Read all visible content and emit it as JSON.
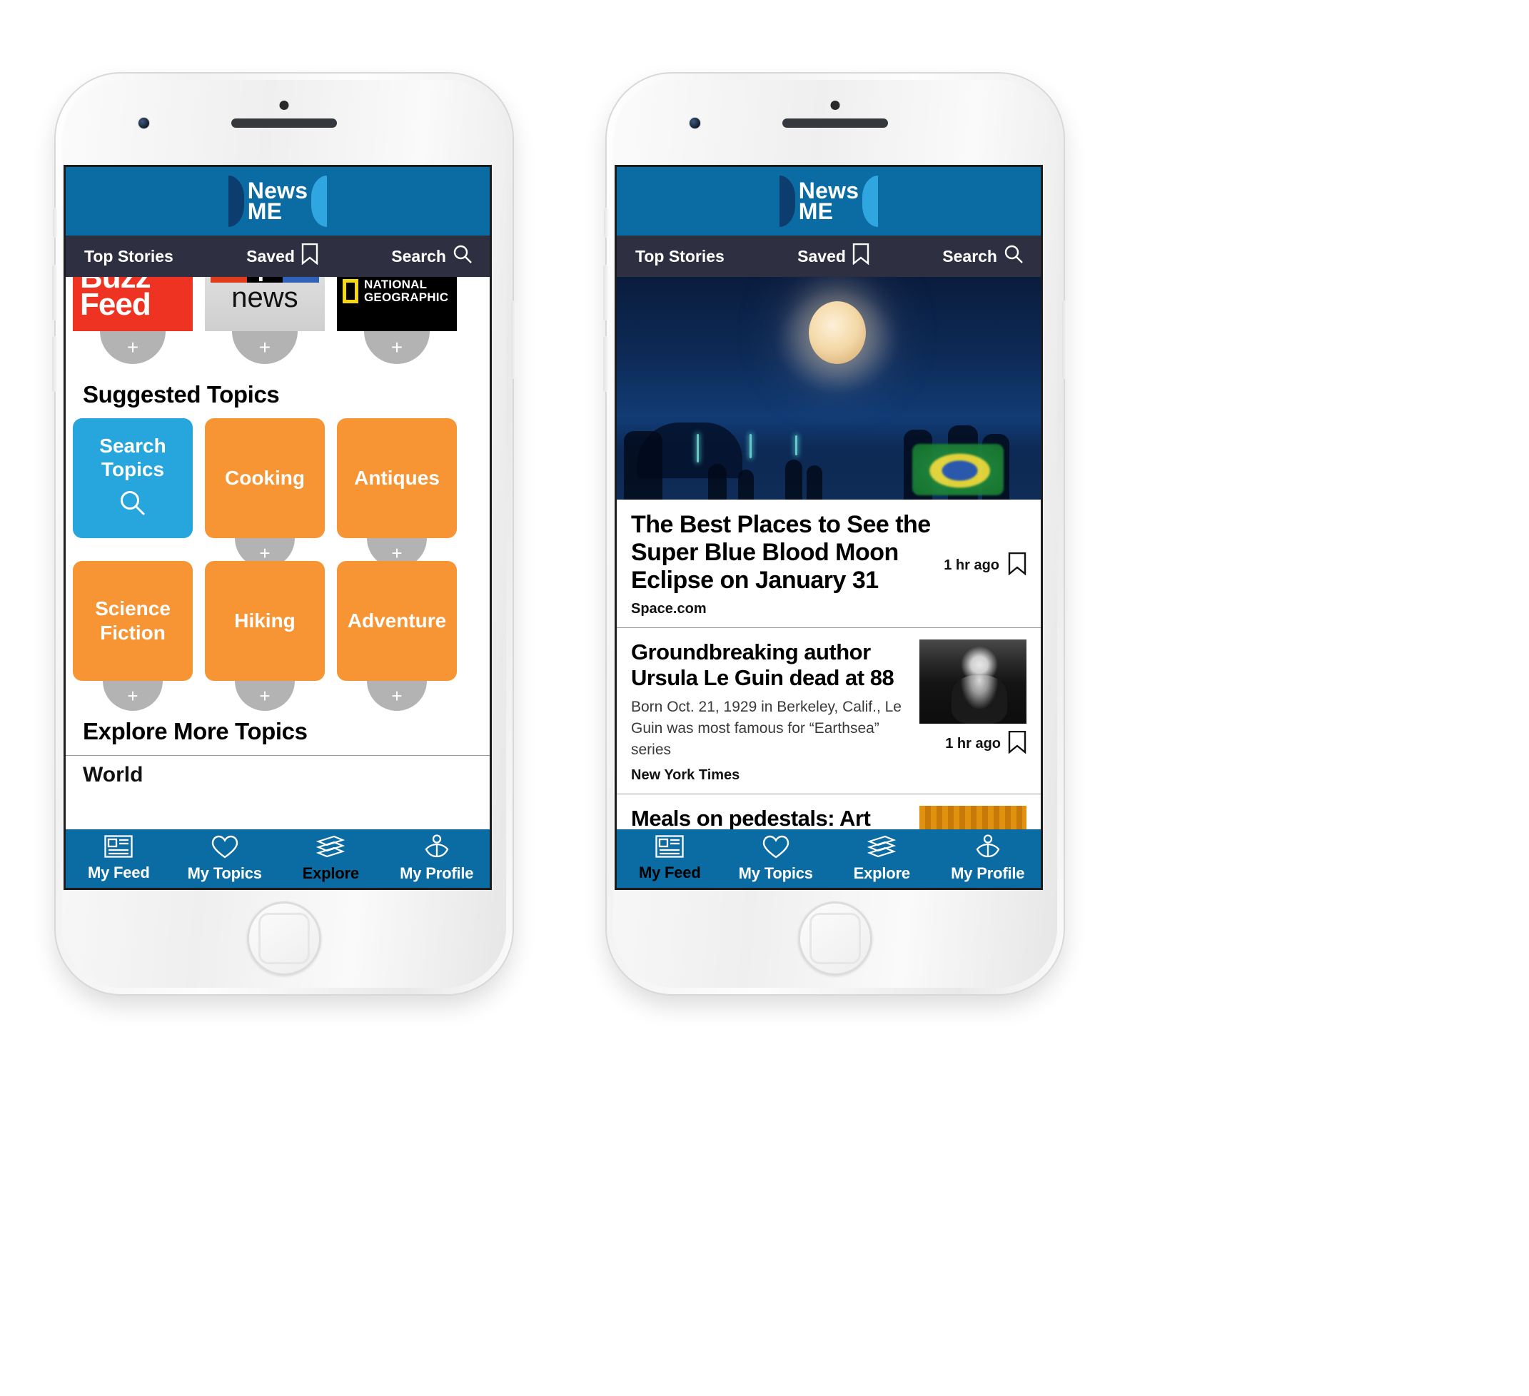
{
  "brand": {
    "line1": "News",
    "line2": "ME",
    "bar_color": "#0a6ca2",
    "nav_color": "#2e2f40"
  },
  "nav": {
    "top_stories": "Top Stories",
    "saved": "Saved",
    "search": "Search",
    "saved_icon": "bookmark-icon",
    "search_icon": "search-icon"
  },
  "tabs": [
    {
      "label": "My Feed",
      "icon": "newspaper-icon"
    },
    {
      "label": "My Topics",
      "icon": "heart-icon"
    },
    {
      "label": "Explore",
      "icon": "books-stack-icon"
    },
    {
      "label": "My Profile",
      "icon": "reader-person-icon"
    }
  ],
  "phone_left": {
    "active_tab": "Explore",
    "publishers": [
      {
        "name": "BuzzFeed",
        "line1": "Buzz",
        "line2": "Feed",
        "add_label": "+"
      },
      {
        "name": "NPR News",
        "letters": [
          "n",
          "p",
          "r"
        ],
        "word": "news",
        "add_label": "+"
      },
      {
        "name": "National Geographic",
        "line1": "NATIONAL",
        "line2": "GEOGRAPHIC",
        "add_label": "+"
      }
    ],
    "suggested_topics_heading": "Suggested Topics",
    "topics": [
      {
        "label": "Search Topics",
        "type": "search",
        "color": "#27a5dd",
        "icon": "search-icon"
      },
      {
        "label": "Cooking",
        "type": "topic",
        "color": "#f79433",
        "add_label": "+"
      },
      {
        "label": "Antiques",
        "type": "topic",
        "color": "#f79433",
        "add_label": "+"
      },
      {
        "label": "Science Fiction",
        "type": "topic",
        "color": "#f79433",
        "add_label": "+"
      },
      {
        "label": "Hiking",
        "type": "topic",
        "color": "#f79433",
        "add_label": "+"
      },
      {
        "label": "Adventure",
        "type": "topic",
        "color": "#f79433",
        "add_label": "+"
      }
    ],
    "explore_more_heading": "Explore More Topics",
    "explore_more_items": [
      "World"
    ]
  },
  "phone_right": {
    "active_tab": "My Feed",
    "articles": [
      {
        "title": "The Best Places to See the Super Blue Blood Moon Eclipse on January 31",
        "source": "Space.com",
        "time": "1 hr ago",
        "has_hero": true,
        "hero_alt": "super-blue-blood-moon-over-beach",
        "bookmark_icon": "bookmark-icon"
      },
      {
        "title": "Groundbreaking author Ursula Le Guin dead at 88",
        "summary": "Born Oct. 21, 1929 in Berkeley, Calif., Le Guin was most famous for “Earthsea” series",
        "source": "New York Times",
        "time": "1 hr ago",
        "thumb_alt": "portrait-ursula-le-guin",
        "bookmark_icon": "bookmark-icon"
      },
      {
        "title": "Meals on pedestals: Art gallery restaurants",
        "summary": "",
        "source": "",
        "time": "",
        "thumb_alt": "plated-dish-orange-curtain",
        "bookmark_icon": "bookmark-icon"
      }
    ]
  }
}
